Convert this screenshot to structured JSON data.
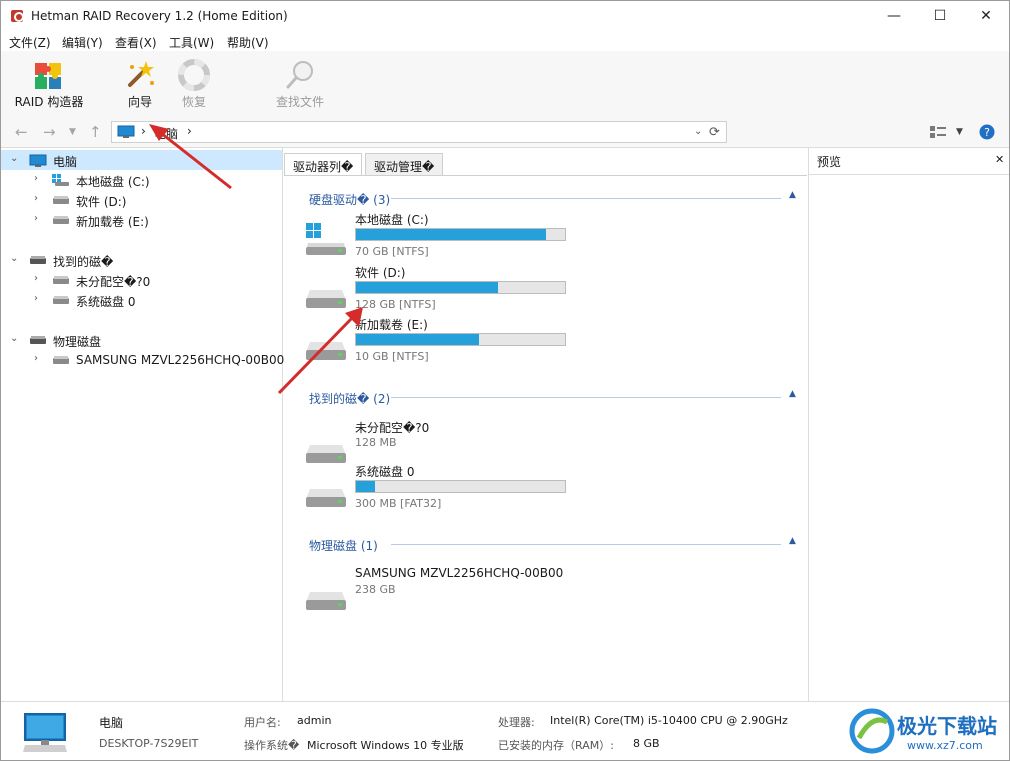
{
  "window": {
    "title": "Hetman RAID Recovery 1.2 (Home Edition)",
    "minimize": "—",
    "maximize": "☐",
    "close": "✕"
  },
  "menu": [
    "文件(Z)",
    "编辑(Y)",
    "查看(X)",
    "工具(W)",
    "帮助(V)"
  ],
  "toolbar": {
    "raid_builder": "RAID 构造器",
    "wizard": "向导",
    "restore": "恢复",
    "find_file": "查找文件"
  },
  "address": {
    "path_label": "电脑",
    "separator": "›"
  },
  "tree": {
    "computer": {
      "label": "电脑",
      "children": [
        "本地磁盘 (C:)",
        "软件 (D:)",
        "新加载卷 (E:)"
      ]
    },
    "found": {
      "label": "找到的磁�",
      "children": [
        "未分配空�?0",
        "系统磁盘 0"
      ]
    },
    "physical": {
      "label": "物理磁盘",
      "children": [
        "SAMSUNG MZVL2256HCHQ-00B00"
      ]
    }
  },
  "tabs": {
    "drive_list": "驱动器列�",
    "drive_manager": "驱动管理�"
  },
  "groups": {
    "hdd": {
      "title": "硬盘驱动�",
      "count": "(3)",
      "items": [
        {
          "name": "本地磁盘 (C:)",
          "info": "70 GB [NTFS]",
          "used": 0.91
        },
        {
          "name": "软件 (D:)",
          "info": "128 GB [NTFS]",
          "used": 0.68
        },
        {
          "name": "新加载卷 (E:)",
          "info": "10 GB [NTFS]",
          "used": 0.59
        }
      ]
    },
    "found": {
      "title": "找到的磁�",
      "count": "(2)",
      "items": [
        {
          "name": "未分配空�?0",
          "info": "128 MB"
        },
        {
          "name": "系统磁盘 0",
          "info": "300 MB [FAT32]",
          "used": 0.09
        }
      ]
    },
    "physical": {
      "title": "物理磁盘",
      "count": "(1)",
      "items": [
        {
          "name": "SAMSUNG MZVL2256HCHQ-00B00",
          "info": "238 GB"
        }
      ]
    }
  },
  "preview": {
    "title": "预览",
    "close": "✕"
  },
  "status": {
    "computer_name": "电脑",
    "host": "DESKTOP-7S29EIT",
    "user_label": "用户名:",
    "user_value": "admin",
    "os_label": "操作系统�",
    "os_value": "Microsoft Windows 10 专业版",
    "cpu_label": "处理器:",
    "cpu_value": "Intel(R) Core(TM) i5-10400 CPU @ 2.90GHz",
    "ram_label": "已安装的内存（RAM）:",
    "ram_value": "8 GB"
  },
  "watermark": {
    "text": "极光下载站",
    "url": "www.xz7.com"
  },
  "colors": {
    "bar_fill": "#26a0da",
    "selection": "#cde8ff",
    "group_title": "#2c5aa0",
    "annotation_arrow": "#d42b2b"
  }
}
